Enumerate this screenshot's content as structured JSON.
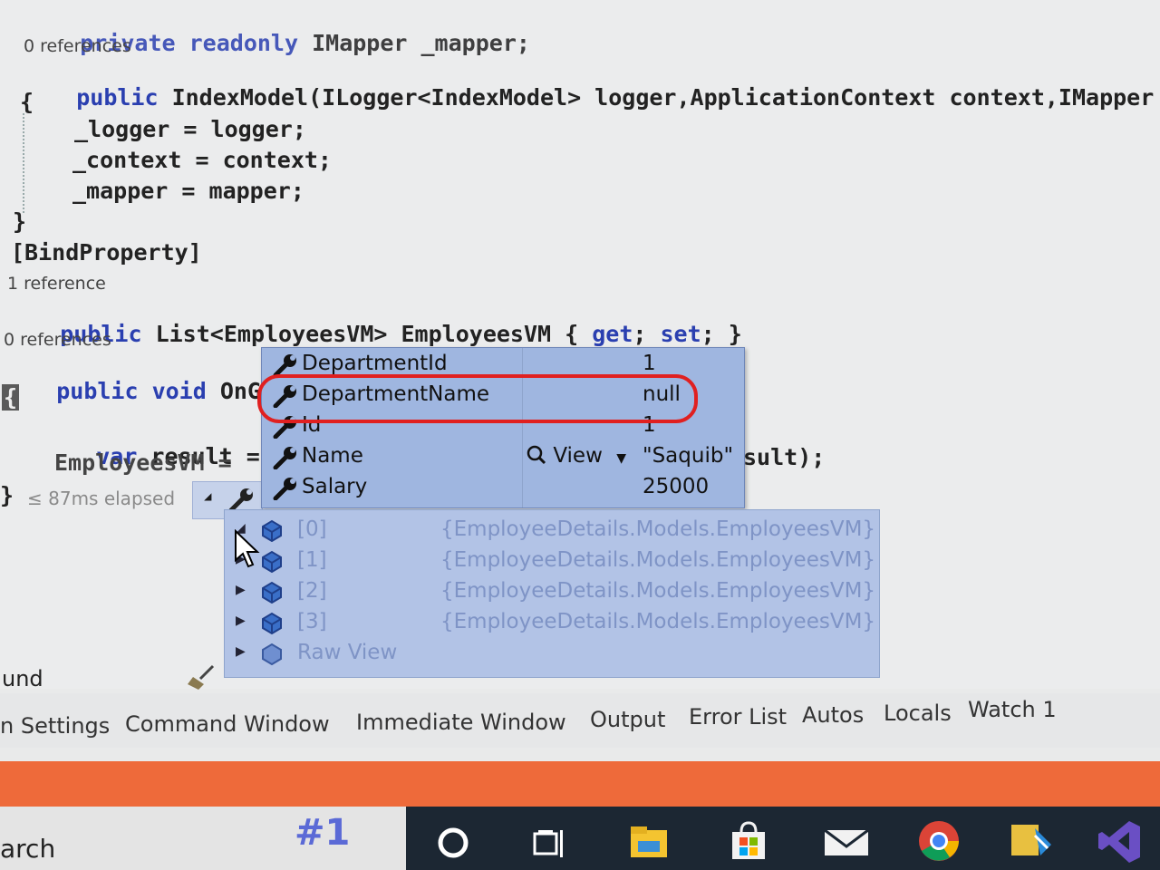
{
  "code": {
    "line1": {
      "kw": "private readonly",
      "rest": " IMapper _mapper;"
    },
    "ref1": "0 references",
    "line2": {
      "kw": "public",
      "rest": " IndexModel(ILogger<IndexModel> logger,ApplicationContext context,IMapper map"
    },
    "line3": "{",
    "line4": "_logger = logger;",
    "line5": "_context = context;",
    "line6": "_mapper = mapper;",
    "line7": "}",
    "line8": "[BindProperty]",
    "ref2": "1 reference",
    "line9": {
      "kw": "public",
      "mid": " List<EmployeesVM> EmployeesVM { ",
      "get": "get",
      "sep": "; ",
      "set": "set",
      "end": "; }"
    },
    "ref3": "0 references",
    "line10": {
      "kw": "public void",
      "rest": " OnGet("
    },
    "line11": "{",
    "line12": {
      "kw": "var",
      "rest": " result = _c"
    },
    "line13": "EmployeesVM =",
    "line13_tail": "sult);",
    "line14": "}"
  },
  "elapsed": "≤ 87ms elapsed",
  "datatip": {
    "rows": [
      {
        "name": "DepartmentId",
        "value": "1"
      },
      {
        "name": "DepartmentName",
        "value": "null"
      },
      {
        "name": "Id",
        "value": "1"
      },
      {
        "name": "Name",
        "value": "\"Saquib\"",
        "view_label": "View"
      },
      {
        "name": "Salary",
        "value": "25000"
      }
    ]
  },
  "list": {
    "rows": [
      {
        "index": "[0]",
        "type": "{EmployeeDetails.Models.EmployeesVM}"
      },
      {
        "index": "[1]",
        "type": "{EmployeeDetails.Models.EmployeesVM}"
      },
      {
        "index": "[2]",
        "type": "{EmployeeDetails.Models.EmployeesVM}"
      },
      {
        "index": "[3]",
        "type": "{EmployeeDetails.Models.EmployeesVM}"
      },
      {
        "index": "Raw View",
        "type": ""
      }
    ]
  },
  "status_fragment": "und",
  "tabs": [
    "n Settings",
    "Command Window",
    "Immediate Window",
    "Output",
    "Error List",
    "Autos",
    "Locals",
    "Watch 1"
  ],
  "taskbar": {
    "search_fragment": "arch",
    "hash_label": "#1",
    "icons": [
      "cortana-icon",
      "task-view-icon",
      "file-explorer-icon",
      "store-icon",
      "mail-icon",
      "chrome-icon",
      "app-icon",
      "visual-studio-icon"
    ]
  },
  "colors": {
    "highlight": "#e02020",
    "keyword": "#2a3fb0",
    "datatip": "#9fb6e0"
  }
}
